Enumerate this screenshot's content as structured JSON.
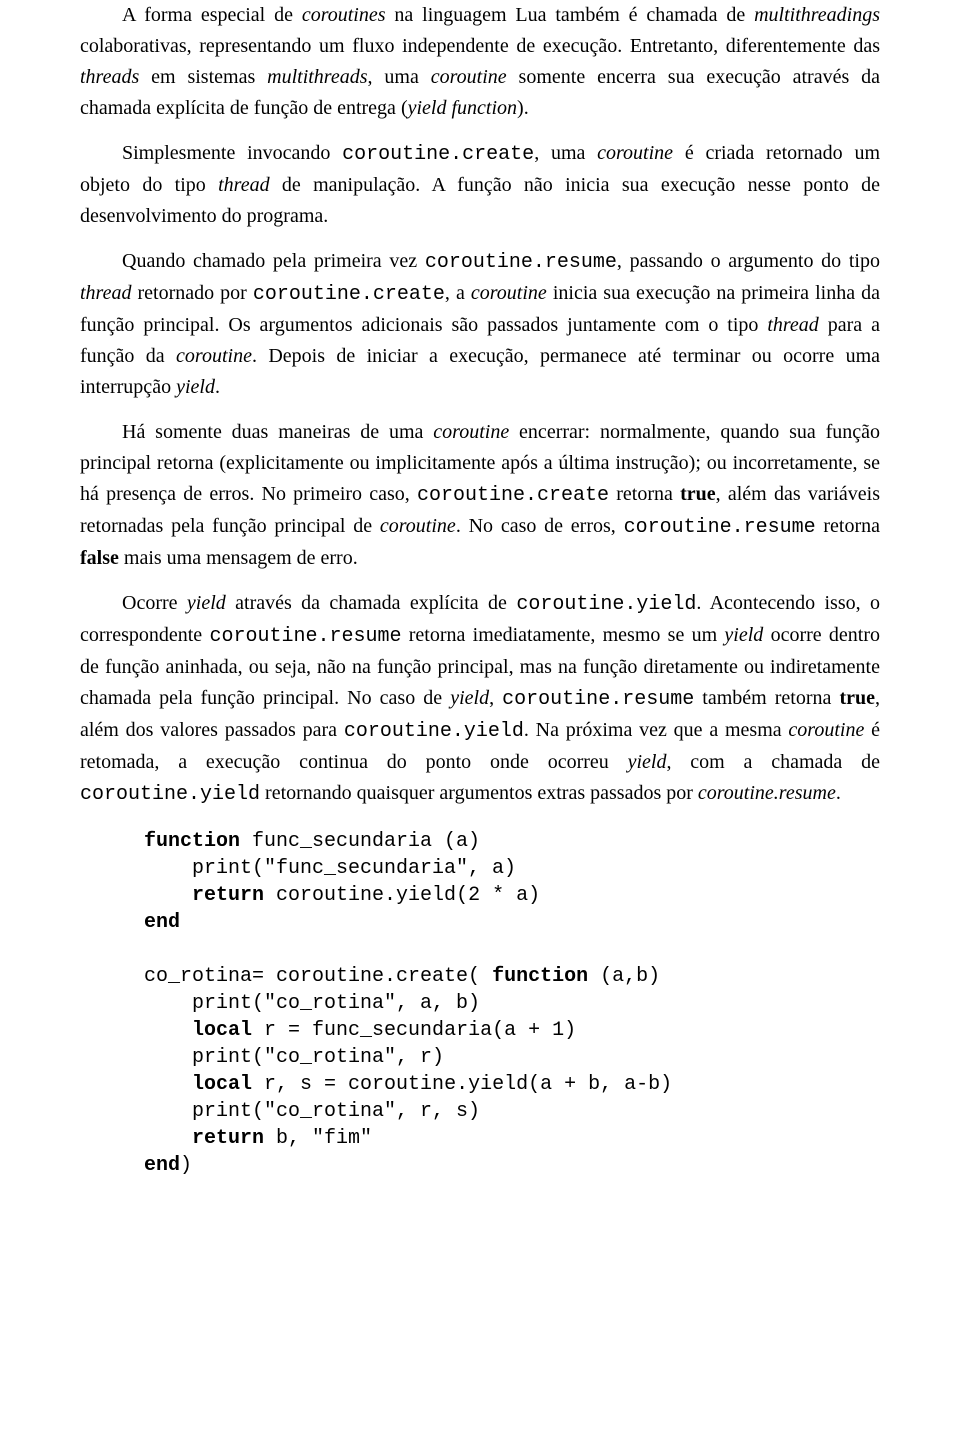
{
  "para": {
    "p1": {
      "a": "A forma especial de ",
      "b": "coroutines",
      "c": " na linguagem Lua também é chamada de ",
      "d": "multithreadings",
      "e": " colaborativas, representando um fluxo independente de execução. Entretanto, diferentemente das ",
      "f": "threads",
      "g": " em sistemas ",
      "h": "multithreads",
      "i": ", uma ",
      "j": "coroutine",
      "k": " somente encerra sua execução através da chamada explícita de função de entrega (",
      "l": "yield function",
      "m": ")."
    },
    "p2": {
      "a": "Simplesmente invocando ",
      "b": "coroutine.create",
      "c": ", uma ",
      "d": "coroutine",
      "e": " é criada retornado um objeto do tipo ",
      "f": "thread",
      "g": " de manipulação. A função não inicia sua execução nesse ponto de desenvolvimento do programa."
    },
    "p3": {
      "a": "Quando chamado pela primeira vez ",
      "b": "coroutine.resume",
      "c": ", passando o argumento do tipo ",
      "d": "thread",
      "e": " retornado por ",
      "f": "coroutine.create",
      "g": ", a ",
      "h": "coroutine",
      "i": " inicia sua execução na primeira linha da função principal. Os argumentos adicionais são passados juntamente com o tipo ",
      "j": "thread",
      "k": " para a função da ",
      "l": "coroutine",
      "m": ". Depois de iniciar a execução, permanece até terminar ou ocorre uma interrupção ",
      "n": "yield",
      "o": "."
    },
    "p4": {
      "a": "Há somente duas maneiras de uma ",
      "b": "coroutine",
      "c": " encerrar: normalmente, quando sua função principal retorna (explicitamente ou implicitamente após a última instrução); ou incorretamente, se há presença de erros. No primeiro caso, ",
      "d": "coroutine.create",
      "e": " retorna ",
      "f": "true",
      "g": ", além das variáveis retornadas pela função principal de ",
      "h": "coroutine",
      "i": ". No caso de erros, ",
      "j": "coroutine.resume",
      "k": " retorna ",
      "l": "false",
      "m": " mais uma mensagem de erro."
    },
    "p5": {
      "a": "Ocorre ",
      "b": "yield",
      "c": " através da chamada explícita de ",
      "d": "coroutine.yield",
      "e": ". Acontecendo isso, o correspondente ",
      "f": "coroutine.resume",
      "g": " retorna imediatamente, mesmo se um ",
      "h": "yield",
      "i": " ocorre dentro de função aninhada, ou seja, não na função principal, mas na função diretamente ou indiretamente chamada pela função principal. No caso de ",
      "j": "yield",
      "k": ", ",
      "l": "coroutine.resume",
      "m": " também retorna ",
      "n": "true",
      "o": ", além dos valores passados para ",
      "p": "coroutine.yield",
      "q": ". Na próxima vez que a mesma ",
      "r": "coroutine",
      "s": " é retomada, a execução continua do ponto onde ocorreu ",
      "t": "yield",
      "u": ", com a chamada de ",
      "v": "coroutine.yield",
      "w": " retornando quaisquer argumentos extras passados por ",
      "x": "coroutine.resume",
      "y": "."
    }
  },
  "code": {
    "l1a": "function",
    "l1b": " func_secundaria (a)",
    "l2": "    print(\"func_secundaria\", a)",
    "l3a": "    ",
    "l3b": "return",
    "l3c": " coroutine.yield(2 * a)",
    "l4": "end",
    "blank1": "",
    "l5a": "co_rotina= coroutine.create( ",
    "l5b": "function",
    "l5c": " (a,b)",
    "l6": "    print(\"co_rotina\", a, b)",
    "l7a": "    ",
    "l7b": "local",
    "l7c": " r = func_secundaria(a + 1)",
    "l8": "    print(\"co_rotina\", r)",
    "l9a": "    ",
    "l9b": "local",
    "l9c": " r, s = coroutine.yield(a + b, a-b)",
    "l10": "    print(\"co_rotina\", r, s)",
    "l11a": "    ",
    "l11b": "return",
    "l11c": " b, \"fim\"",
    "l12a": "end",
    "l12b": ")"
  }
}
